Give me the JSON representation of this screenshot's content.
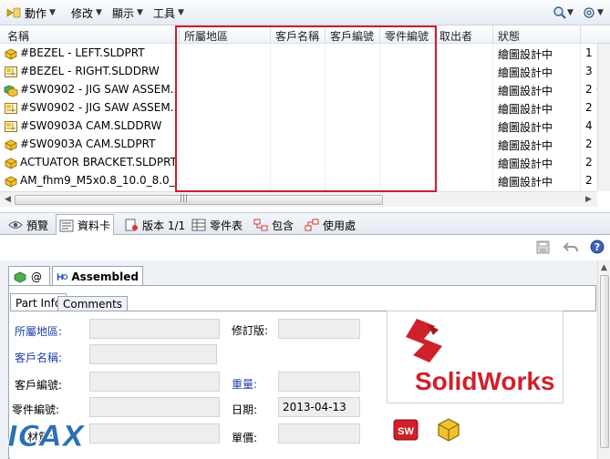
{
  "toolbar": {
    "actions_label": "動作",
    "modify_label": "修改",
    "display_label": "顯示",
    "tools_label": "工具"
  },
  "list": {
    "columns": [
      "名稱",
      "所屬地區",
      "客戶名稱",
      "客戶編號",
      "零件編號",
      "取出者",
      "狀態"
    ],
    "rows": [
      {
        "name": "#BEZEL - LEFT.SLDPRT",
        "icon": "part-icon",
        "status": "繪圖設計中",
        "extra": "1"
      },
      {
        "name": "#BEZEL - RIGHT.SLDDRW",
        "icon": "drawing-icon",
        "status": "繪圖設計中",
        "extra": "3"
      },
      {
        "name": "#SW0902 - JIG SAW ASSEM...",
        "icon": "assembly-icon",
        "status": "繪圖設計中",
        "extra": "2 ·"
      },
      {
        "name": "#SW0902 - JIG SAW ASSEM...",
        "icon": "drawing-icon",
        "status": "繪圖設計中",
        "extra": "2"
      },
      {
        "name": "#SW0903A CAM.SLDDRW",
        "icon": "drawing-icon",
        "status": "繪圖設計中",
        "extra": "4"
      },
      {
        "name": "#SW0903A CAM.SLDPRT",
        "icon": "part-icon",
        "status": "繪圖設計中",
        "extra": "2"
      },
      {
        "name": "ACTUATOR BRACKET.SLDPRT",
        "icon": "part-icon",
        "status": "繪圖設計中",
        "extra": "2"
      },
      {
        "name": "AM_fhm9_M5x0.8_10.0_8.0_...",
        "icon": "part-icon",
        "status": "繪圖設計中",
        "extra": "2"
      }
    ]
  },
  "tabs": [
    {
      "label": "預覽",
      "icon": "preview-icon"
    },
    {
      "label": "資料卡",
      "icon": "datacard-icon",
      "active": true
    },
    {
      "label": "版本 1/1",
      "icon": "version-icon"
    },
    {
      "label": "零件表",
      "icon": "bom-icon"
    },
    {
      "label": "包含",
      "icon": "contains-icon"
    },
    {
      "label": "使用處",
      "icon": "where-used-icon"
    }
  ],
  "card": {
    "config_tab_at": "@",
    "config_tab_assembled": "Assembled",
    "inner_tab_partinfo": "Part Info",
    "inner_tab_comments": "Comments",
    "region_label": "所屬地區:",
    "customer_name_label": "客戶名稱:",
    "customer_no_label": "客戶編號:",
    "part_no_label": "零件編號:",
    "material_label": "材質:",
    "revision_label": "修訂版:",
    "weight_label": "重量:",
    "date_label": "日期:",
    "date_value": "2013-04-13",
    "price_label": "單價:",
    "logo_text": "SolidWorks",
    "watermark_text": "ICAX"
  },
  "colors": {
    "highlight": "#c8202e",
    "link": "#1f3fa8",
    "solidworks_red": "#d0202a"
  }
}
